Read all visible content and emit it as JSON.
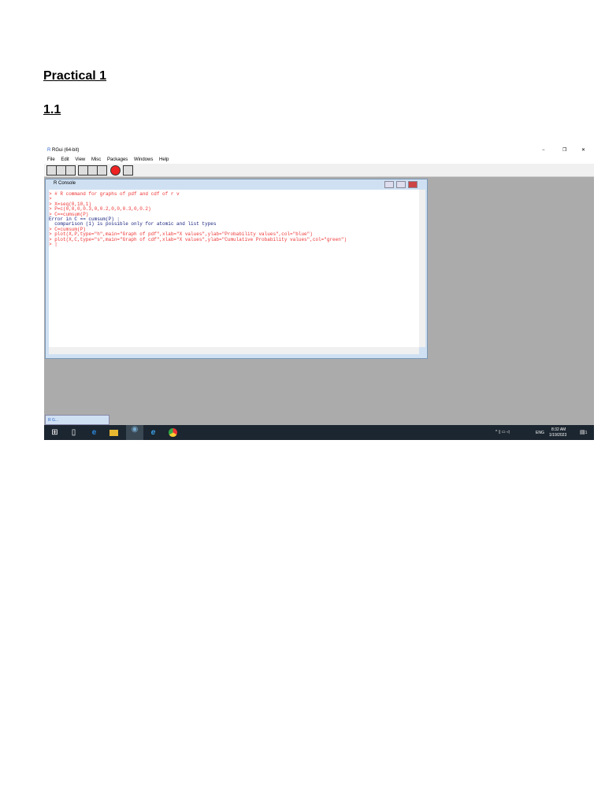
{
  "doc": {
    "title": "Practical 1",
    "section": "1.1"
  },
  "app": {
    "title": "RGui (64-bit)",
    "menu": [
      "File",
      "Edit",
      "View",
      "Misc",
      "Packages",
      "Windows",
      "Help"
    ],
    "window_controls": [
      "−",
      "❐",
      "✕"
    ]
  },
  "console": {
    "title": "R Console",
    "minimized_label": "R G...",
    "lines": [
      {
        "t": "> # R command for graphs of pdf and cdf of r v",
        "k": "in"
      },
      {
        "t": ">",
        "k": "in"
      },
      {
        "t": "> X=seq(0,10,1)",
        "k": "in"
      },
      {
        "t": "> P=c(0,0,0,0.3,0,0.2,0,0,0.3,0,0.2)",
        "k": "in"
      },
      {
        "t": "> C==cumsum(P)",
        "k": "in"
      },
      {
        "t": "Error in C == cumsum(P) :",
        "k": "out"
      },
      {
        "t": "  comparison (1) is possible only for atomic and list types",
        "k": "out"
      },
      {
        "t": "> C=cumsum(P)",
        "k": "in"
      },
      {
        "t": "> plot(X,P,type=\"h\",main=\"Graph of pdf\",xlab=\"X values\",ylab=\"Probability values\",col=\"blue\")",
        "k": "in"
      },
      {
        "t": "> plot(X,C,type=\"s\",main=\"Graph of cdf\",xlab=\"X values\",ylab=\"Cumulative Probability values\",col=\"green\")",
        "k": "in"
      },
      {
        "t": "> |",
        "k": "in"
      }
    ]
  },
  "taskbar": {
    "lang": "ENG",
    "time": "8:32 AM",
    "date": "1/19/2023",
    "notifications": "1"
  }
}
